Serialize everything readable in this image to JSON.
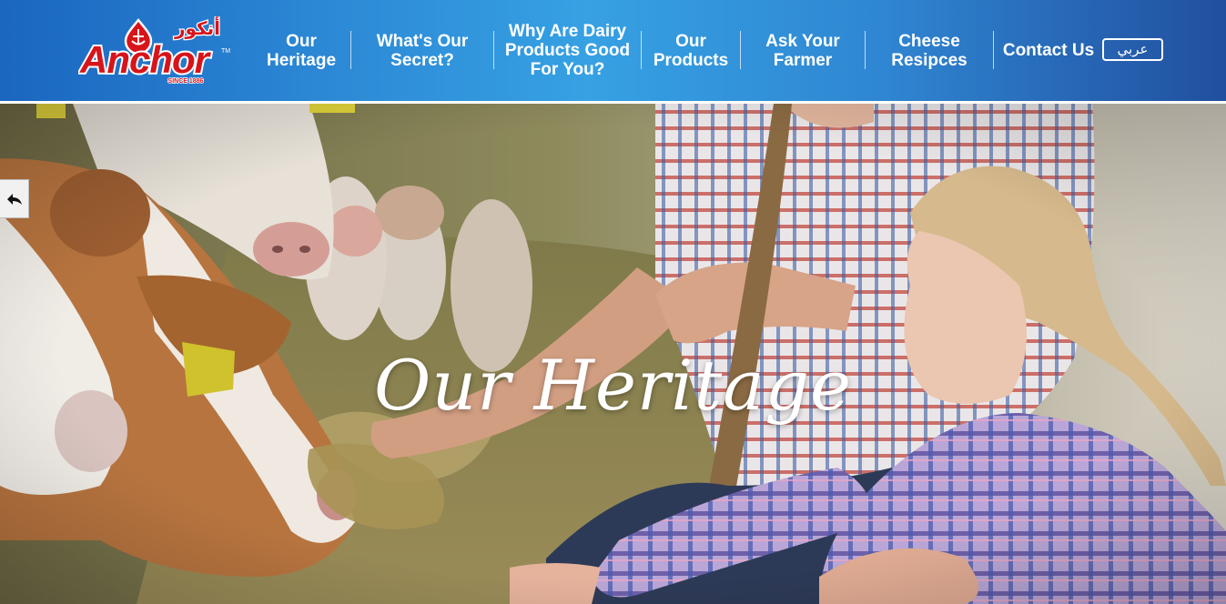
{
  "brand": {
    "name": "Anchor",
    "arabic_name": "أنكور",
    "trademark": "TM",
    "since": "SINCE 1886",
    "colors": {
      "red": "#d7141a",
      "white": "#ffffff"
    }
  },
  "header": {
    "gradient": [
      "#1a66c0",
      "#36a1e3",
      "#214f9f"
    ],
    "nav": [
      {
        "label": "Our\nHeritage"
      },
      {
        "label": "What's Our\nSecret?"
      },
      {
        "label": "Why Are Dairy\nProducts Good\nFor You?"
      },
      {
        "label": "Our\nProducts"
      },
      {
        "label": "Ask Your\nFarmer"
      },
      {
        "label": "Cheese\nResipces"
      },
      {
        "label": "Contact Us"
      }
    ],
    "language_button": "عربي"
  },
  "hero": {
    "title": "Our Heritage",
    "image_description_icon": "farm-family-feeding-cows-photo"
  },
  "back_tab": {
    "icon": "reply-arrow-icon"
  }
}
